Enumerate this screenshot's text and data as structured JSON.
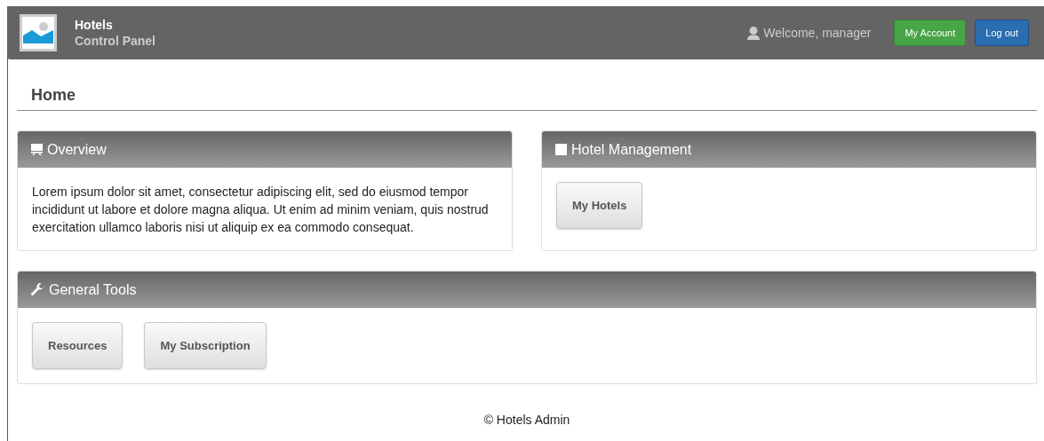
{
  "header": {
    "title": "Hotels",
    "subtitle": "Control Panel",
    "welcome": "Welcome, manager",
    "account_button": "My Account",
    "logout_button": "Log out"
  },
  "page_title": "Home",
  "rows": [
    [
      {
        "title": "Overview",
        "kind": "text",
        "text": "Lorem ipsum dolor sit amet, consectetur adipiscing elit, sed do eiusmod tempor incididunt ut labore et dolore magna aliqua. Ut enim ad minim veniam, quis nostrud exercitation ullamco laboris nisi ut aliquip ex ea commodo consequat."
      },
      {
        "title": "Hotel Management",
        "kind": "buttons",
        "buttons": [
          "My Hotels"
        ]
      }
    ],
    [
      {
        "title": "General Tools",
        "kind": "buttons",
        "buttons": [
          "Resources",
          "My Subscription"
        ]
      }
    ]
  ],
  "footer": "© Hotels Admin"
}
